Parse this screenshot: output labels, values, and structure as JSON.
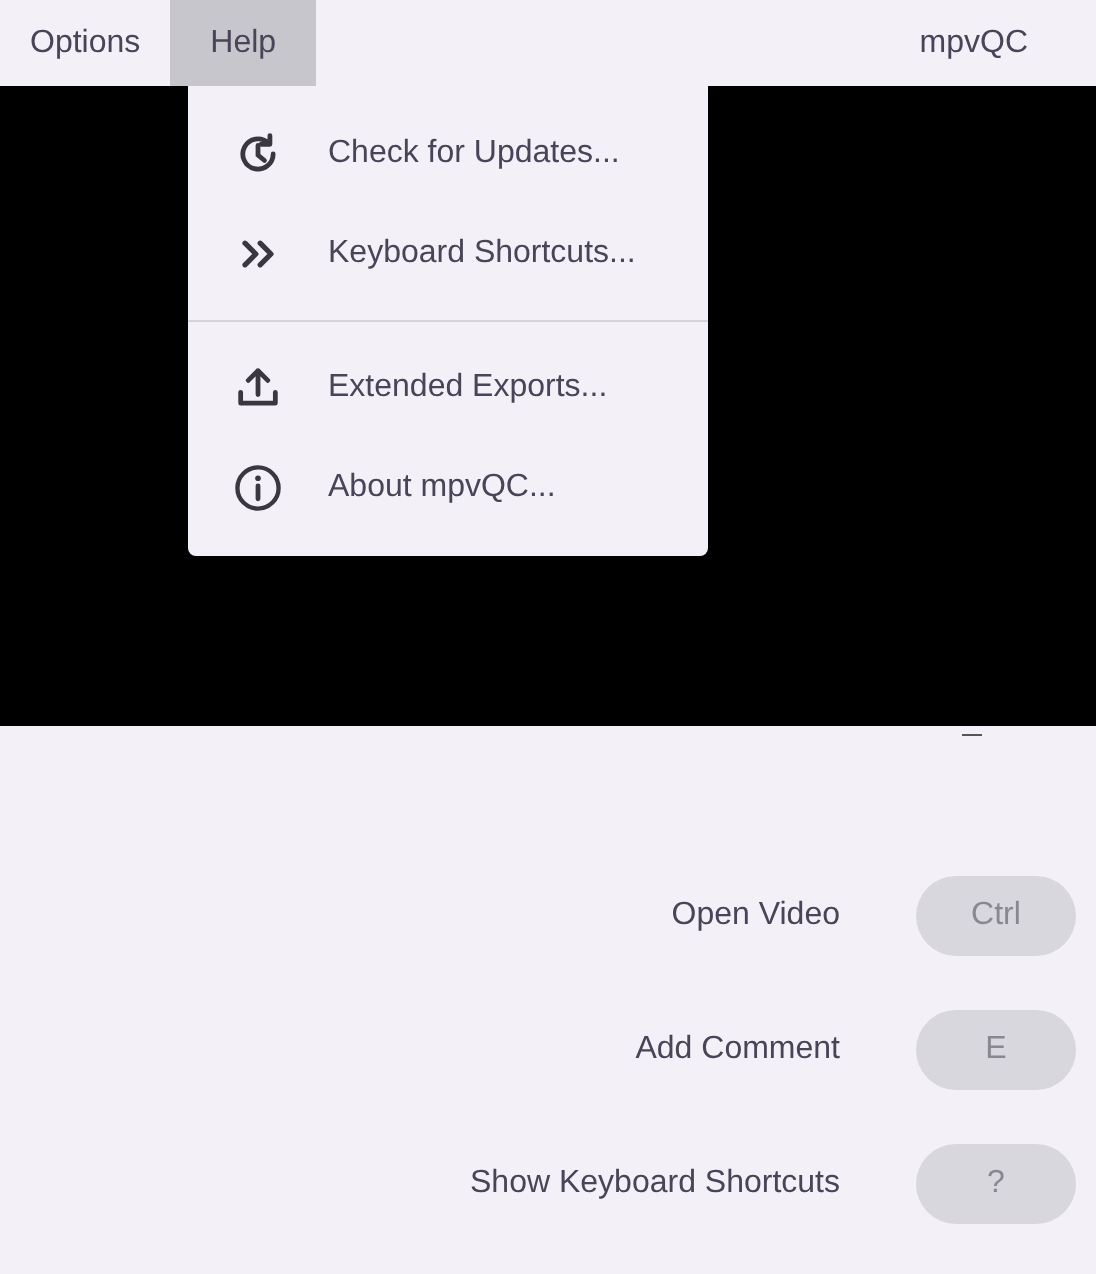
{
  "menu_bar": [
    {
      "label": "Options",
      "selected": false
    },
    {
      "label": "Help",
      "selected": true
    }
  ],
  "app_title": "mpvQC",
  "help_menu": {
    "groups": [
      [
        {
          "label": "Check for Updates..."
        },
        {
          "label": "Keyboard Shortcuts..."
        }
      ],
      [
        {
          "label": "Extended Exports..."
        },
        {
          "label": "About mpvQC..."
        }
      ]
    ]
  },
  "shortcuts": [
    {
      "label": "Open Video",
      "key": "Ctrl"
    },
    {
      "label": "Add Comment",
      "key": "E"
    },
    {
      "label": "Show Keyboard Shortcuts",
      "key": "?"
    }
  ]
}
